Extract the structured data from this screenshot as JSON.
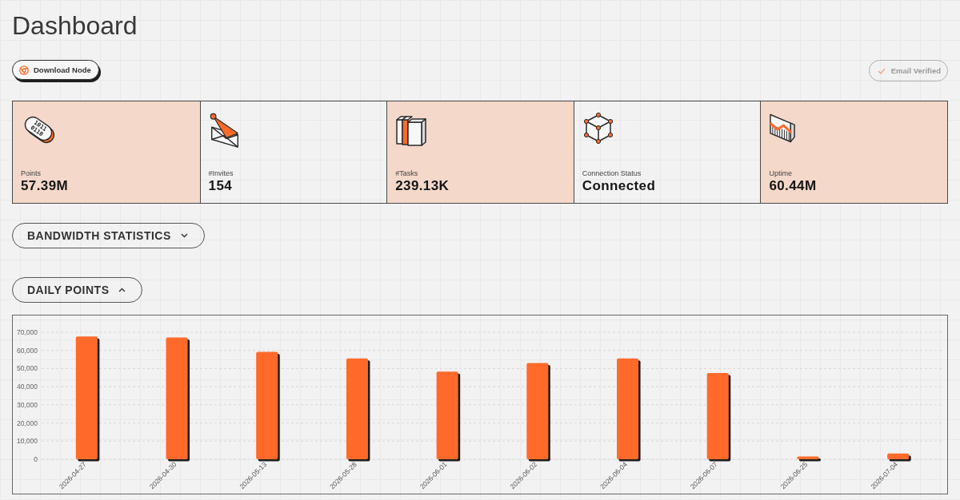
{
  "page": {
    "title": "Dashboard"
  },
  "toolbar": {
    "download": {
      "label": "Download Node"
    },
    "verification": {
      "label": "Email Verified",
      "disabled": true
    }
  },
  "stats": [
    {
      "label": "Points",
      "value": "57.39M",
      "icon_text": [
        "1011",
        "0110"
      ]
    },
    {
      "label": "#Invites",
      "value": "154"
    },
    {
      "label": "#Tasks",
      "value": "239.13K"
    },
    {
      "label": "Connection Status",
      "value": "Connected"
    },
    {
      "label": "Uptime",
      "value": "60.44M"
    }
  ],
  "sections": [
    {
      "title": "BANDWIDTH STATISTICS",
      "expanded": false
    },
    {
      "title": "DAILY POINTS",
      "expanded": true,
      "chart_data": {
        "type": "bar",
        "grid": true,
        "categories": [
          "2026-04-27",
          "2026-04-30",
          "2026-05-13",
          "2026-05-28",
          "2026-06-01",
          "2026-06-02",
          "2026-06-04",
          "2026-06-07",
          "2026-06-25",
          "2026-07-04"
        ],
        "values": [
          67700,
          67100,
          59200,
          55600,
          48300,
          53100,
          55600,
          47500,
          1500,
          3200
        ],
        "ylim": [
          0,
          70000
        ],
        "yticks": [
          {
            "value": 0,
            "label": "0"
          },
          {
            "value": 10000,
            "label": "10,000"
          },
          {
            "value": 20000,
            "label": "20,000"
          },
          {
            "value": 30000,
            "label": "30,000"
          },
          {
            "value": 40000,
            "label": "40,000"
          },
          {
            "value": 50000,
            "label": "50,000"
          },
          {
            "value": 60000,
            "label": "60,000"
          },
          {
            "value": 70000,
            "label": "70,000"
          }
        ]
      }
    }
  ]
}
